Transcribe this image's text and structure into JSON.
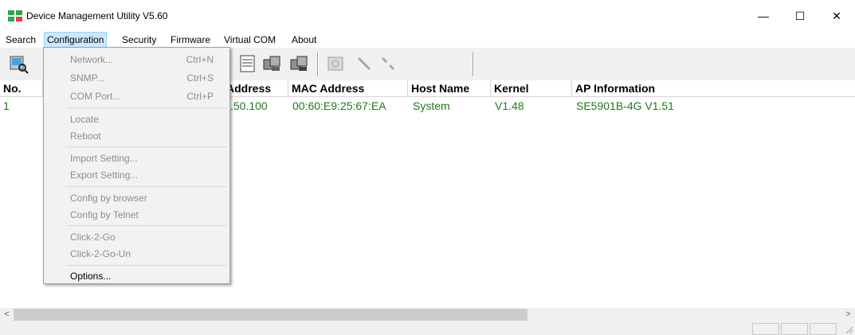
{
  "window": {
    "title": "Device Management Utility V5.60",
    "minimize": "—",
    "maximize": "☐",
    "close": "✕"
  },
  "menubar": [
    "Search",
    "Configuration",
    "Security",
    "Firmware",
    "Virtual COM",
    "About"
  ],
  "toolbar": {
    "icons": [
      "search-device-icon",
      "network-config-icon",
      "device-icon-1",
      "device-icon-2",
      "device-icon-3",
      "locate-icon",
      "link-icon",
      "unlink-icon"
    ]
  },
  "table": {
    "headers": [
      "No.",
      "",
      "",
      "Address",
      "MAC Address",
      "Host Name",
      "Kernel",
      "AP Information"
    ],
    "rows": [
      [
        "1",
        "",
        ".50.100",
        "00:60:E9:25:67:EA",
        "System",
        "V1.48",
        "SE5901B-4G V1.51"
      ]
    ]
  },
  "dropdown": {
    "items": [
      {
        "label": "Network...",
        "shortcut": "Ctrl+N",
        "enabled": false
      },
      {
        "label": "SNMP...",
        "shortcut": "Ctrl+S",
        "enabled": false
      },
      {
        "label": "COM Port...",
        "shortcut": "Ctrl+P",
        "enabled": false
      },
      {
        "label": "Locate",
        "shortcut": "",
        "enabled": false
      },
      {
        "label": "Reboot",
        "shortcut": "",
        "enabled": false
      },
      {
        "label": "Import Setting...",
        "shortcut": "",
        "enabled": false
      },
      {
        "label": "Export Setting...",
        "shortcut": "",
        "enabled": false
      },
      {
        "label": "Config by browser",
        "shortcut": "",
        "enabled": false
      },
      {
        "label": "Config by Telnet",
        "shortcut": "",
        "enabled": false
      },
      {
        "label": "Click-2-Go",
        "shortcut": "",
        "enabled": false
      },
      {
        "label": "Click-2-Go-Un",
        "shortcut": "",
        "enabled": false
      },
      {
        "label": "Options...",
        "shortcut": "",
        "enabled": true
      }
    ]
  },
  "scroll": {
    "left_arrow": "<",
    "right_arrow": ">"
  },
  "colors": {
    "row_text": "#1e7a1e",
    "menu_highlight": "#cce8ff",
    "disabled_text": "#8d8d8d"
  }
}
